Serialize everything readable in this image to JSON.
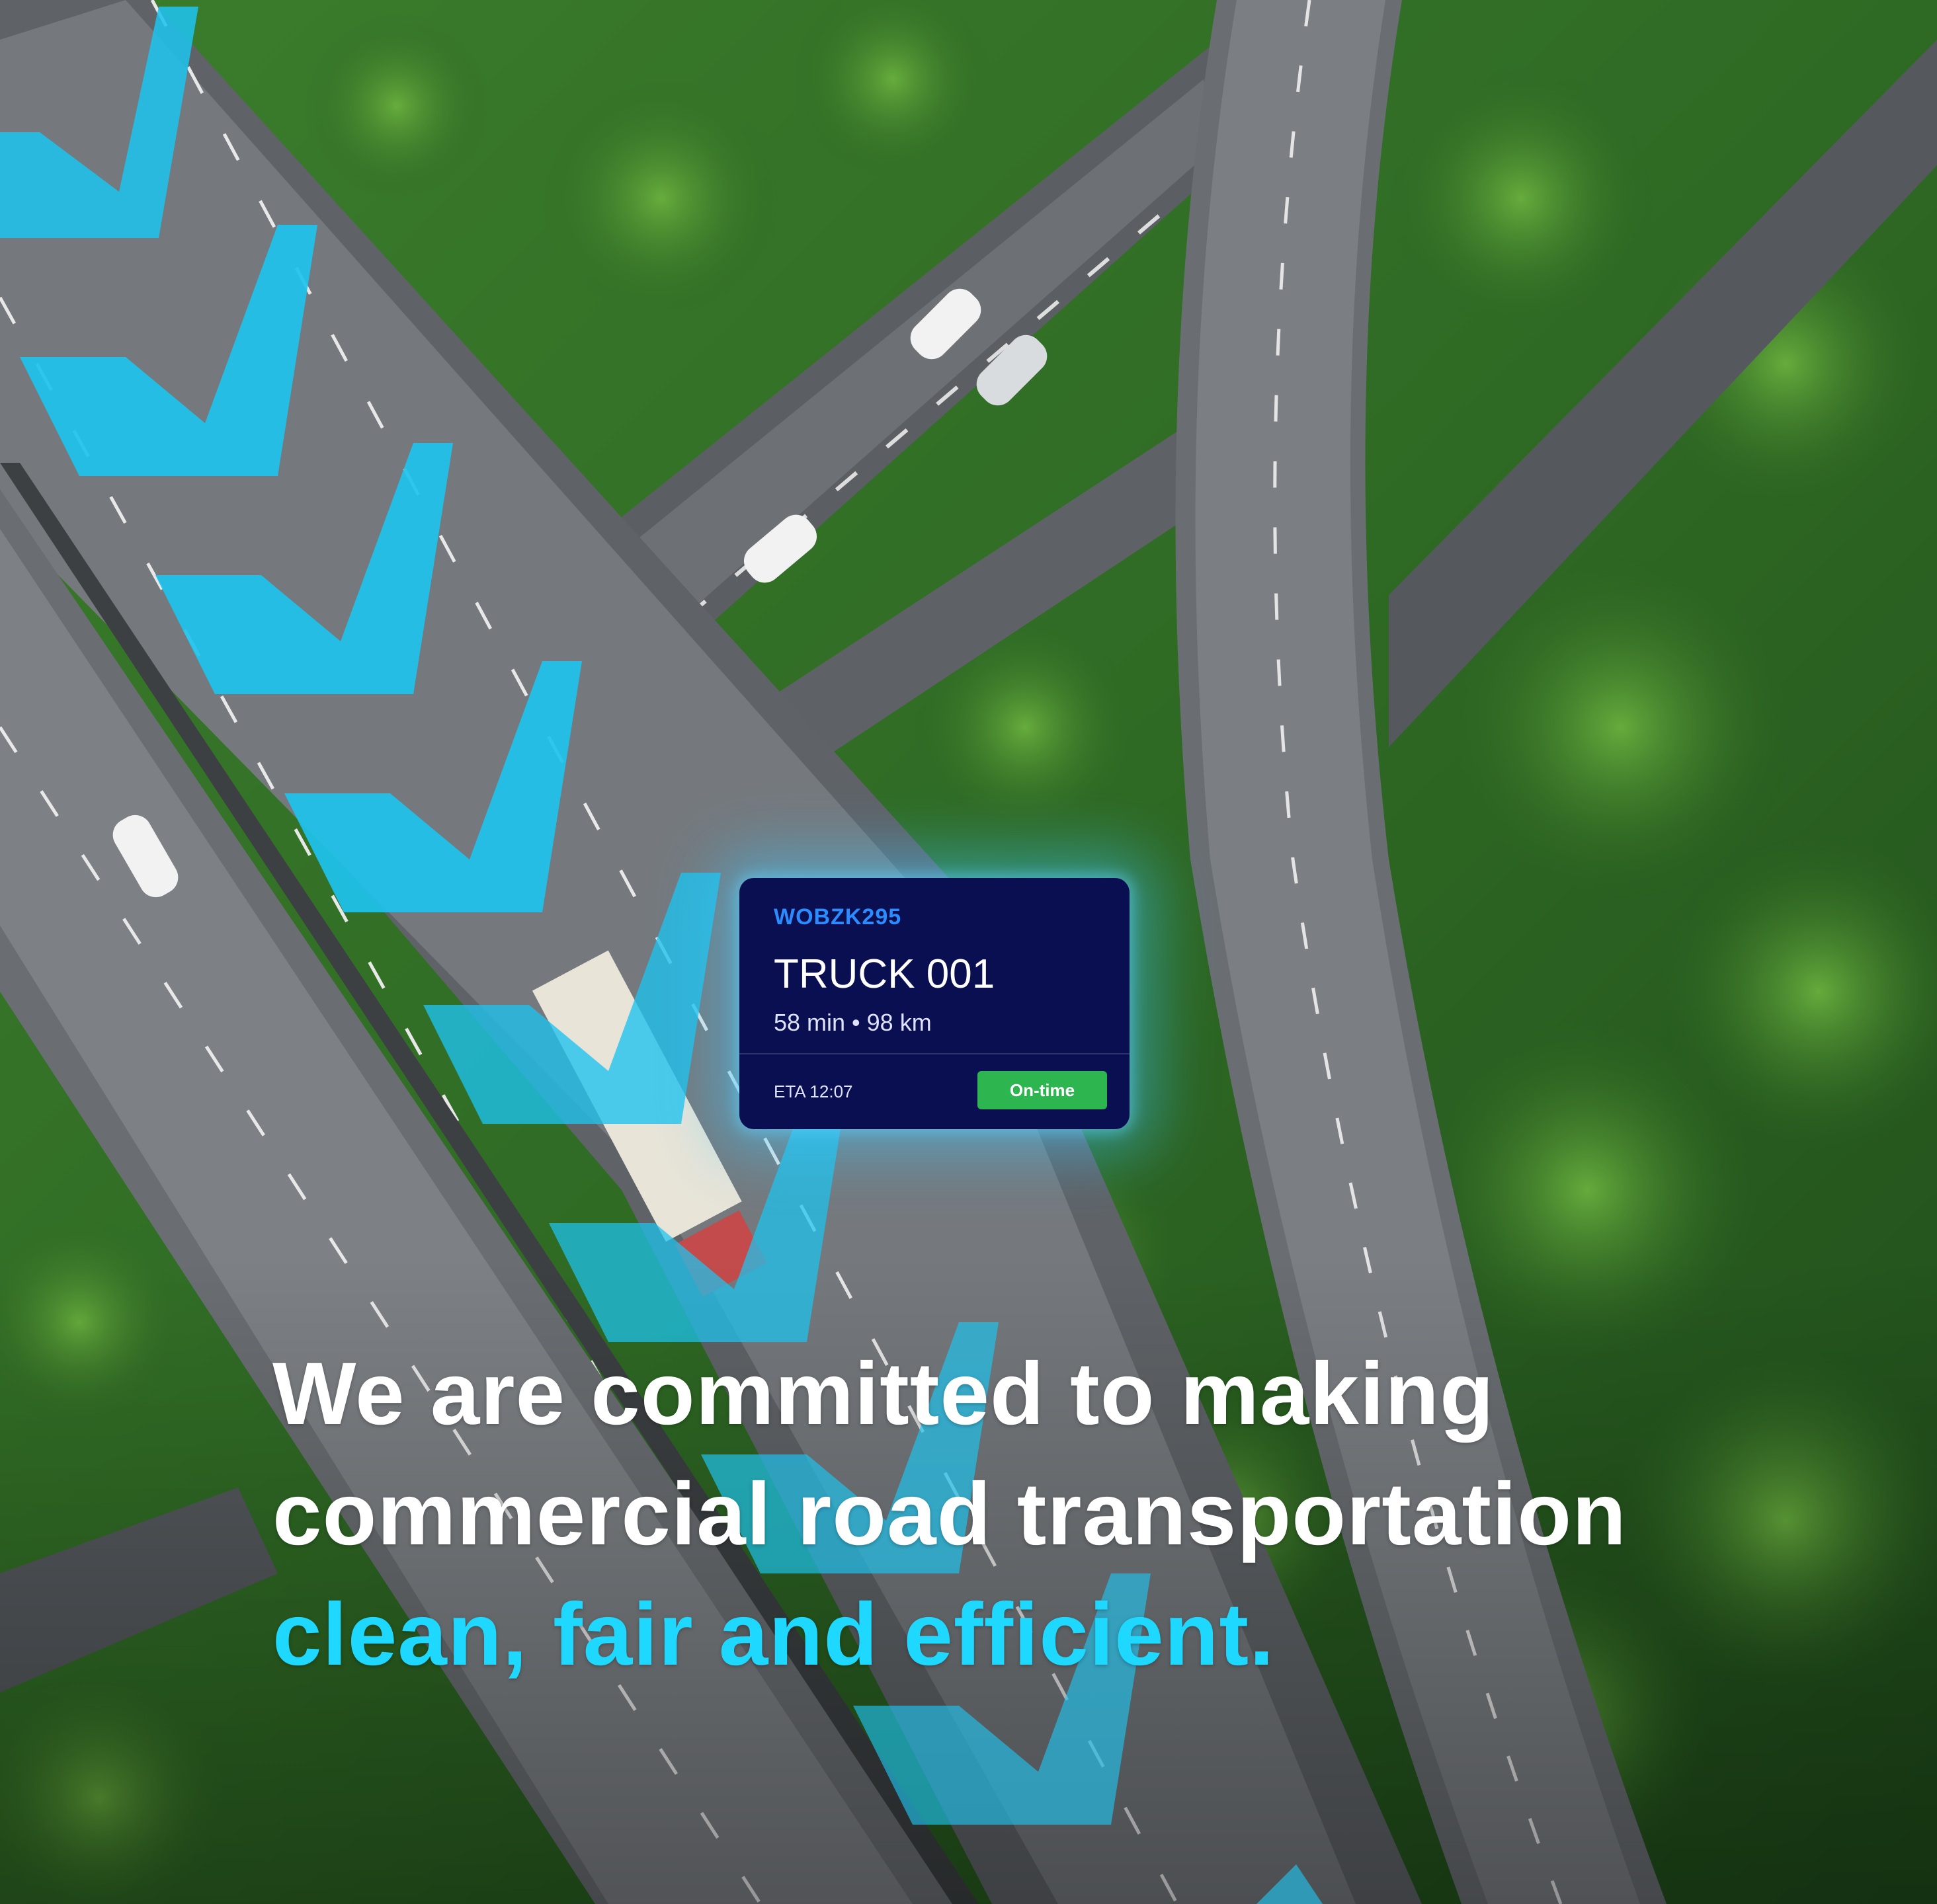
{
  "card": {
    "id": "WOBZK295",
    "title": "TRUCK 001",
    "meta": "58 min • 98 km",
    "eta": "ETA 12:07",
    "status": "On-time"
  },
  "headline": {
    "line1": "We are committed to making",
    "line2": "commercial road transportation",
    "line3": "clean, fair and efficient."
  },
  "colors": {
    "accent": "#1ed8ff",
    "card_bg": "#0a0f52",
    "status_green": "#2db54f",
    "chevron": "#1fc3ee"
  }
}
